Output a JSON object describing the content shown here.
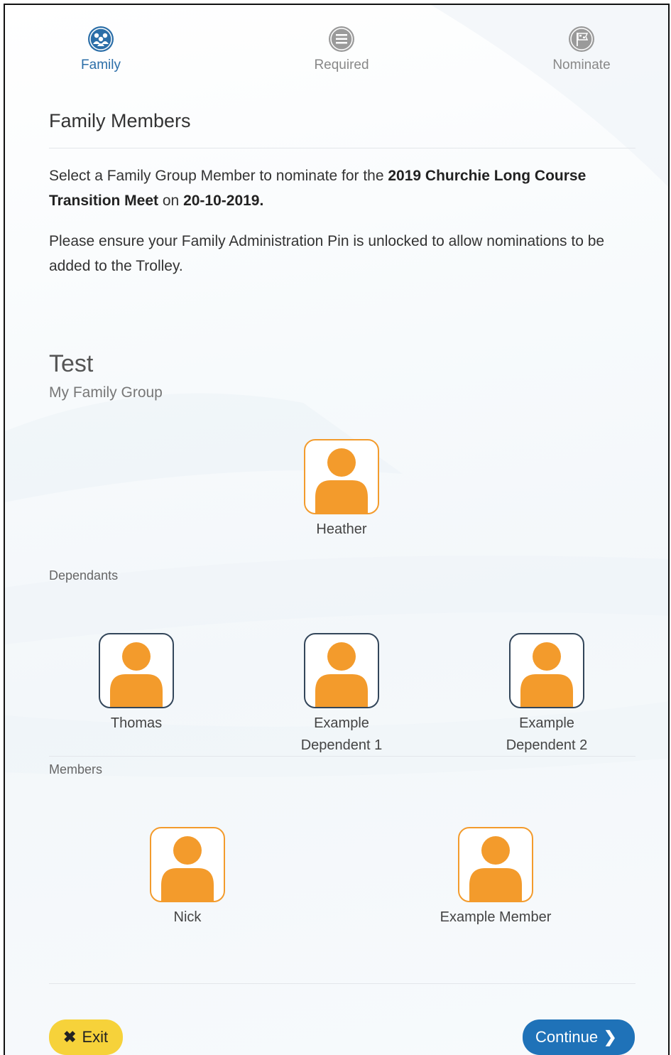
{
  "stepper": {
    "steps": [
      {
        "label": "Family",
        "icon": "family-icon",
        "active": true
      },
      {
        "label": "Required",
        "icon": "list-icon",
        "active": false
      },
      {
        "label": "Nominate",
        "icon": "flag-icon",
        "active": false
      }
    ]
  },
  "section": {
    "title": "Family Members",
    "intro": {
      "prefix": "Select a Family Group Member to nominate for the ",
      "meet_name": "2019 Churchie Long Course Transition Meet",
      "middle": " on ",
      "meet_date": "20-10-2019.",
      "suffix": ""
    },
    "notice": "Please ensure your Family Administration Pin is unlocked to allow nominations to be added to the Trolley."
  },
  "group": {
    "name": "Test",
    "subtitle": "My Family Group",
    "head": {
      "name": "Heather"
    },
    "dependants_label": "Dependants",
    "dependants": [
      {
        "name": "Thomas"
      },
      {
        "name": "Example Dependent 1"
      },
      {
        "name": "Example Dependent 2"
      }
    ],
    "members_label": "Members",
    "members": [
      {
        "name": "Nick"
      },
      {
        "name": "Example Member"
      }
    ]
  },
  "actions": {
    "exit_label": "Exit",
    "continue_label": "Continue"
  },
  "colors": {
    "accent_blue": "#1f72b8",
    "avatar_orange": "#f39b2c",
    "exit_yellow": "#f6d23a"
  }
}
